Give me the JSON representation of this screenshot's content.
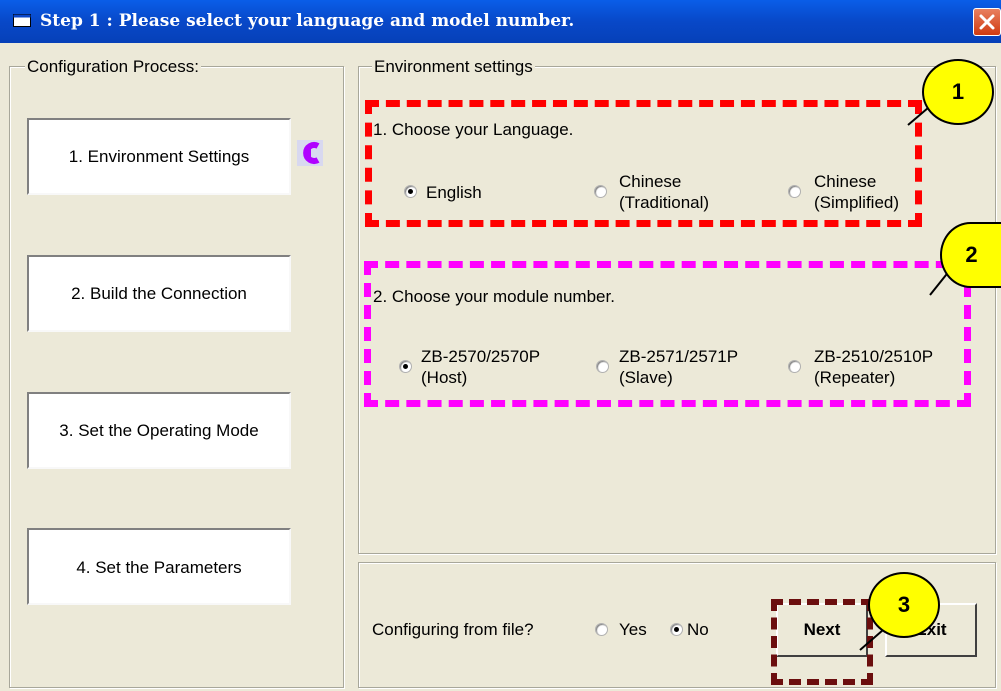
{
  "window": {
    "title": "Step 1 : Please select your language and model number.",
    "colors": {
      "titlebar": "#0848c8",
      "face": "#ece9d8"
    }
  },
  "left_panel": {
    "group_label": "Configuration Process:",
    "steps": [
      {
        "label": "1. Environment Settings"
      },
      {
        "label": "2. Build the Connection"
      },
      {
        "label": "3. Set the Operating Mode"
      },
      {
        "label": "4. Set the Parameters"
      }
    ],
    "current_indicator_icon": "back-arrow-icon"
  },
  "environment": {
    "group_label": "Environment settings",
    "language": {
      "heading": "1. Choose your Language.",
      "options": [
        {
          "line1": "English",
          "line2": "",
          "selected": true
        },
        {
          "line1": "Chinese",
          "line2": "(Traditional)",
          "selected": false
        },
        {
          "line1": "Chinese",
          "line2": "(Simplified)",
          "selected": false
        }
      ]
    },
    "module": {
      "heading": "2. Choose your module number.",
      "options": [
        {
          "line1": "ZB-2570/2570P",
          "line2": "(Host)",
          "selected": true
        },
        {
          "line1": "ZB-2571/2571P",
          "line2": "(Slave)",
          "selected": false
        },
        {
          "line1": "ZB-2510/2510P",
          "line2": "(Repeater)",
          "selected": false
        }
      ]
    }
  },
  "footer": {
    "question": "Configuring from file?",
    "yes_label": "Yes",
    "no_label": "No",
    "selected": "No",
    "next_label": "Next",
    "exit_label": "Exit"
  },
  "callouts": [
    "1",
    "2",
    "3"
  ],
  "annotation_colors": {
    "box1": "#ff0000",
    "box2": "#ff00ff",
    "box3": "#6b0e0e",
    "callout": "#ffff00"
  }
}
